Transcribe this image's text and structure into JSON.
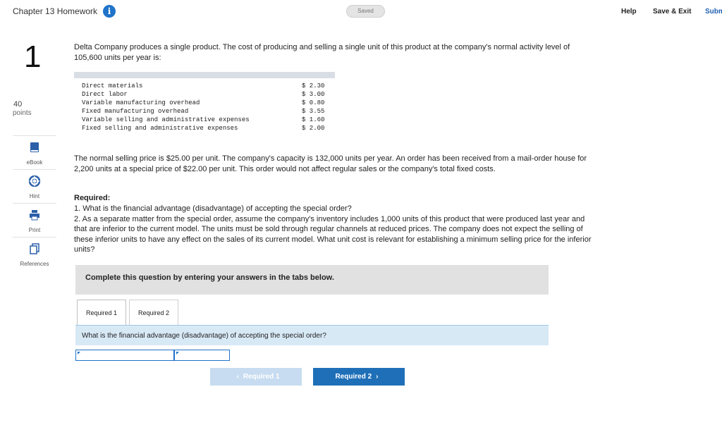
{
  "header": {
    "title": "Chapter 13 Homework",
    "status": "Saved",
    "help": "Help",
    "save_exit": "Save & Exit",
    "submit": "Submit",
    "accent": "#1f73c9"
  },
  "question": {
    "number": "1",
    "points_value": "40",
    "points_label": "points"
  },
  "tools": [
    {
      "label": "eBook",
      "icon": "book-icon"
    },
    {
      "label": "Hint",
      "icon": "lifebuoy-icon"
    },
    {
      "label": "Print",
      "icon": "printer-icon"
    },
    {
      "label": "References",
      "icon": "references-icon"
    }
  ],
  "content": {
    "intro": "Delta Company produces a single product. The cost of producing and selling a single unit of this product at the company's normal activity level of 105,600 units per year is:",
    "costs": [
      {
        "name": "Direct materials",
        "value": "$ 2.30"
      },
      {
        "name": "Direct labor",
        "value": "$ 3.00"
      },
      {
        "name": "Variable manufacturing overhead",
        "value": "$ 0.80"
      },
      {
        "name": "Fixed manufacturing overhead",
        "value": "$ 3.55"
      },
      {
        "name": "Variable selling and administrative expenses",
        "value": "$ 1.60"
      },
      {
        "name": "Fixed selling and administrative expenses",
        "value": "$ 2.00"
      }
    ],
    "paragraph2": "The normal selling price is $25.00 per unit. The company's capacity is 132,000 units per year. An order has been received from a mail-order house for 2,200 units at a special price of $22.00 per unit. This order would not affect regular sales or the company's total fixed costs.",
    "required_heading": "Required:",
    "required_text": "1. What is the financial advantage (disadvantage) of accepting the special order?\n2. As a separate matter from the special order, assume the company's inventory includes 1,000 units of this product that were produced last year and that are inferior to the current model. The units must be sold through regular channels at reduced prices. The company does not expect the selling of these inferior units to have any effect on the sales of its current model. What unit cost is relevant for establishing a minimum selling price for the inferior units?"
  },
  "answer_section": {
    "instruction": "Complete this question by entering your answers in the tabs below.",
    "tabs": [
      "Required 1",
      "Required 2"
    ],
    "active_tab": "Required 1",
    "prompt": "What is the financial advantage (disadvantage) of accepting the special order?",
    "answer_label_value": "",
    "answer_amount_value": "",
    "prev_button": "Required 1",
    "next_button": "Required 2"
  }
}
